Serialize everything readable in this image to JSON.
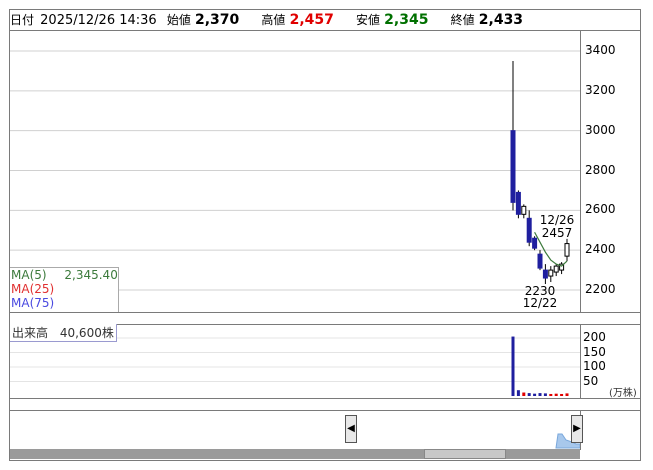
{
  "header": {
    "date_label": "日付",
    "date_value": "2025/12/26 14:36",
    "open_label": "始値",
    "open_value": "2,370",
    "high_label": "高値",
    "high_value": "2,457",
    "low_label": "安値",
    "low_value": "2,345",
    "close_label": "終値",
    "close_value": "2,433"
  },
  "price_axis": [
    "3400",
    "3200",
    "3000",
    "2800",
    "2600",
    "2400",
    "2200"
  ],
  "annotations": {
    "high_date": "12/26",
    "high_price": "2457",
    "low_price": "2230",
    "low_date": "12/22"
  },
  "ma_legend": {
    "ma5_label": "MA(5)",
    "ma5_value": "2,345.40",
    "ma25_label": "MA(25)",
    "ma75_label": "MA(75)"
  },
  "volume": {
    "label": "出来高",
    "value": "40,600株",
    "axis": [
      "200",
      "150",
      "100",
      "50"
    ],
    "unit": "(万株)"
  },
  "colors": {
    "up_candle": "#ffffff",
    "down_candle": "#1f1f9f",
    "ma5": "#3c7a3c",
    "volume_up": "#e00000",
    "volume_down": "#1f1f9f"
  },
  "chart_data": {
    "type": "candlestick",
    "ylim": [
      2150,
      3450
    ],
    "candles": [
      {
        "o": 3000,
        "h": 3350,
        "l": 2600,
        "c": 2640,
        "dir": "down"
      },
      {
        "o": 2690,
        "h": 2700,
        "l": 2560,
        "c": 2580,
        "dir": "down"
      },
      {
        "o": 2580,
        "h": 2630,
        "l": 2560,
        "c": 2620,
        "dir": "up"
      },
      {
        "o": 2560,
        "h": 2600,
        "l": 2420,
        "c": 2440,
        "dir": "down"
      },
      {
        "o": 2460,
        "h": 2470,
        "l": 2400,
        "c": 2410,
        "dir": "down"
      },
      {
        "o": 2380,
        "h": 2400,
        "l": 2300,
        "c": 2310,
        "dir": "down"
      },
      {
        "o": 2300,
        "h": 2330,
        "l": 2230,
        "c": 2260,
        "dir": "down"
      },
      {
        "o": 2270,
        "h": 2320,
        "l": 2240,
        "c": 2300,
        "dir": "up"
      },
      {
        "o": 2290,
        "h": 2330,
        "l": 2270,
        "c": 2320,
        "dir": "up"
      },
      {
        "o": 2300,
        "h": 2340,
        "l": 2280,
        "c": 2330,
        "dir": "up"
      },
      {
        "o": 2370,
        "h": 2457,
        "l": 2345,
        "c": 2433,
        "dir": "up"
      }
    ],
    "ma5": [
      2490,
      2440,
      2390,
      2350,
      2330,
      2320,
      2345
    ],
    "volumes": [
      205,
      20,
      12,
      10,
      8,
      10,
      9,
      7,
      8,
      7,
      9
    ],
    "volume_ylim": [
      0,
      220
    ]
  }
}
